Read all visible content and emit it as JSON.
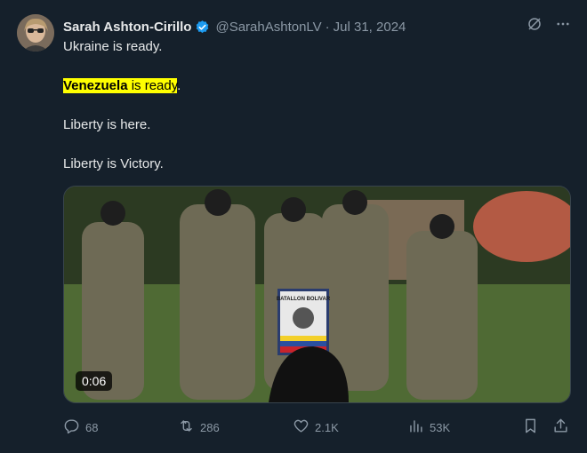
{
  "author": {
    "name": "Sarah Ashton-Cirillo",
    "handle": "@SarahAshtonLV",
    "date": "Jul 31, 2024",
    "verified_color": "#1d9bf0"
  },
  "text": {
    "line1": "Ukraine is ready.",
    "line2_bold": "Venezuela",
    "line2_rest": " is ready",
    "line2_end": ".",
    "line3": "Liberty is here.",
    "line4": "Liberty is Victory."
  },
  "media": {
    "duration": "0:06",
    "sign_text": "BATALLON BOLIVAR"
  },
  "stats": {
    "replies": "68",
    "reposts": "286",
    "likes": "2.1K",
    "views": "53K"
  },
  "colors": {
    "background": "#15202b",
    "text": "#e7e9ea",
    "muted": "#8b98a5",
    "highlight": "#ffff00"
  }
}
